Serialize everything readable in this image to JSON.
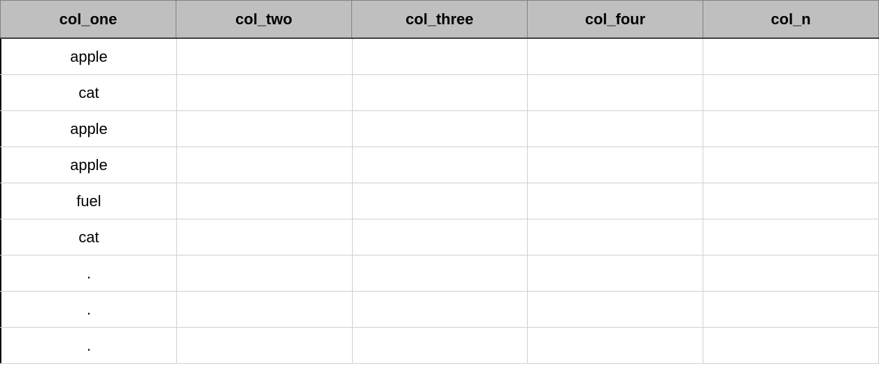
{
  "chart_data": {
    "type": "table",
    "columns": [
      "col_one",
      "col_two",
      "col_three",
      "col_four",
      "col_n"
    ],
    "rows": [
      [
        "apple",
        "",
        "",
        "",
        ""
      ],
      [
        "cat",
        "",
        "",
        "",
        ""
      ],
      [
        "apple",
        "",
        "",
        "",
        ""
      ],
      [
        "apple",
        "",
        "",
        "",
        ""
      ],
      [
        "fuel",
        "",
        "",
        "",
        ""
      ],
      [
        "cat",
        "",
        "",
        "",
        ""
      ],
      [
        ".",
        "",
        "",
        "",
        ""
      ],
      [
        ".",
        "",
        "",
        "",
        ""
      ],
      [
        ".",
        "",
        "",
        "",
        ""
      ]
    ]
  }
}
